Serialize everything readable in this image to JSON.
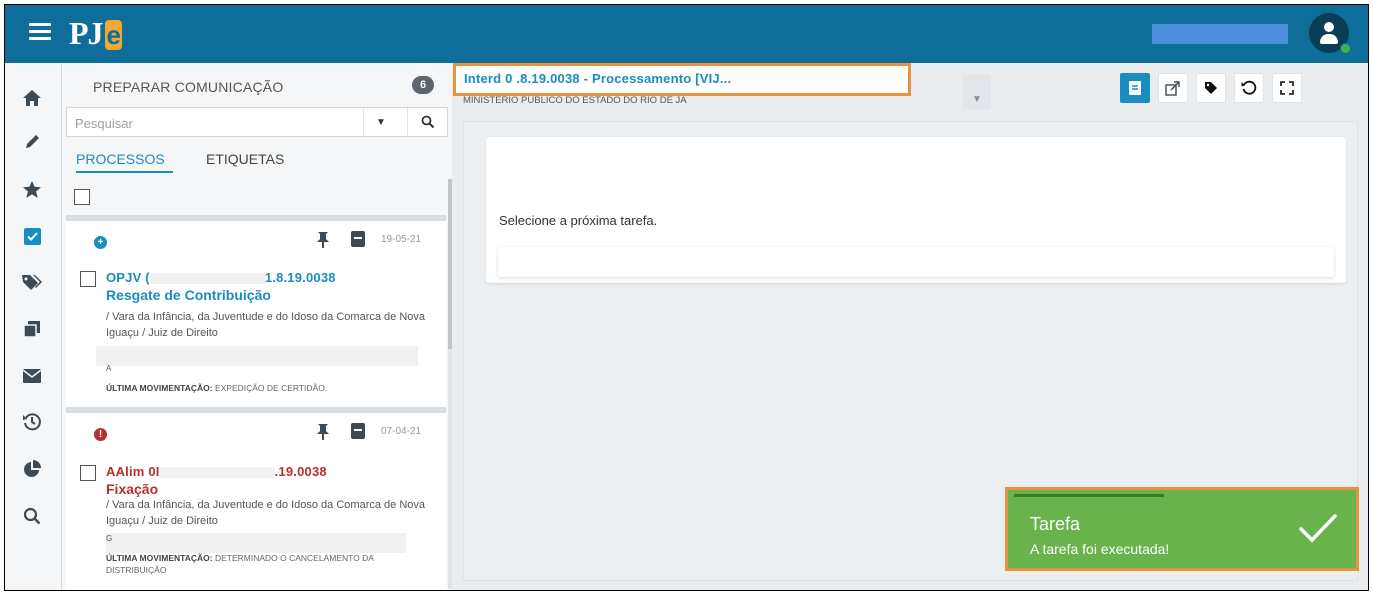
{
  "header": {
    "app_logo": "PJe",
    "colors": {
      "bar": "#0f6e99",
      "accent": "#1a8dbf"
    }
  },
  "rail": {
    "icons": [
      "home-icon",
      "pencil-icon",
      "star-icon",
      "checkbox-icon",
      "tags-icon",
      "copy-icon",
      "envelope-icon",
      "history-icon",
      "pie-chart-icon",
      "search-icon"
    ]
  },
  "panel": {
    "title": "PREPARAR COMUNICAÇÃO",
    "count": "6",
    "search_placeholder": "Pesquisar",
    "tabs": [
      "PROCESSOS",
      "ETIQUETAS"
    ],
    "cards": [
      {
        "status": "info",
        "date": "19-05-21",
        "code_prefix": "OPJV (",
        "code_suffix": "1.8.19.0038",
        "task": "Resgate de Contribuição",
        "desc": "/ Vara da Infância, da Juventude e do Idoso da Comarca de Nova Iguaçu / Juiz de Direito",
        "masked_line": "A",
        "last_label": "ÚLTIMA MOVIMENTAÇÃO:",
        "last_value": "EXPEDIÇÃO DE CERTIDÃO."
      },
      {
        "status": "alert",
        "date": "07-04-21",
        "code_prefix": "AAlim 0I",
        "code_suffix": ".19.0038",
        "task": "Fixação",
        "desc": "/ Vara da Infância, da Juventude e do Idoso da Comarca de Nova Iguaçu / Juiz de Direito",
        "masked_line": "G",
        "last_label": "ÚLTIMA MOVIMENTAÇÃO:",
        "last_value": "DETERMINADO O CANCELAMENTO DA DISTRIBUIÇÃO"
      }
    ]
  },
  "main": {
    "process_title": "Interd 0                              .8.19.0038 - Processamento [VIJ...",
    "subheader": "MINISTERIO PUBLICO DO ESTADO DO RIO DE JA",
    "toolbar_icons": [
      "document-icon",
      "share-icon",
      "tag-icon",
      "history-icon",
      "expand-icon"
    ],
    "task_prompt": "Selecione a próxima tarefa."
  },
  "toast": {
    "title": "Tarefa",
    "message": "A tarefa foi executada!",
    "color": "#68b34c"
  }
}
